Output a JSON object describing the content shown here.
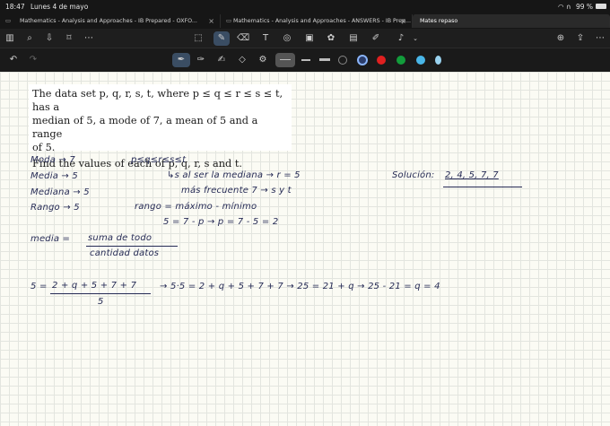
{
  "status_bar": {
    "time": "18:47",
    "date": "Lunes 4 de mayo",
    "battery": "99 %"
  },
  "tabs": [
    {
      "label": "Mathematics - Analysis and Approaches - IB Prepared - OXFO..."
    },
    {
      "label": "Mathematics - Analysis and Approaches - ANSWERS - IB Prep..."
    },
    {
      "label": "Mates repaso"
    }
  ],
  "colors": {
    "pen_black": "#1b1b1b",
    "pen_navy": "#2b3d6b",
    "pen_red": "#e02020",
    "pen_green": "#129c3b",
    "pen_cyan": "#49b6e8",
    "ink": "#262b55"
  },
  "problem": {
    "line1": "The data set p, q, r, s, t, where p ≤ q ≤ r ≤ s ≤ t, has a",
    "line2": "median of 5, a mode of 7, a mean of 5 and a range",
    "line3": "of 5.",
    "question": "Find the values of each of p, q, r, s and t."
  },
  "notes": {
    "moda": "Moda → 7",
    "media": "Media → 5",
    "mediana": "Mediana → 5",
    "rango": "Rango → 5",
    "order": "p≤q≤r≤s≤t",
    "median_note": "↳s al ser la mediana → r = 5",
    "mode_note": "más frecuente 7 → s y t",
    "range_formula": "rango = máximo - mínimo",
    "range_calc": "5 = 7 - p → p = 7 - 5 = 2",
    "solution_label": "Solución:",
    "solution_values": "2, 4, 5, 7, 7",
    "mean_def_label": "media =",
    "mean_def_num": "suma de todo",
    "mean_def_den": "cantidad datos",
    "mean_eq_left": "5 =",
    "mean_eq_num": "2 + q + 5 + 7 + 7",
    "mean_eq_den": "5",
    "mean_eq_steps": "→ 5·5 = 2 + q + 5 + 7 + 7 → 25 = 21 + q → 25 - 21 = q = 4"
  }
}
